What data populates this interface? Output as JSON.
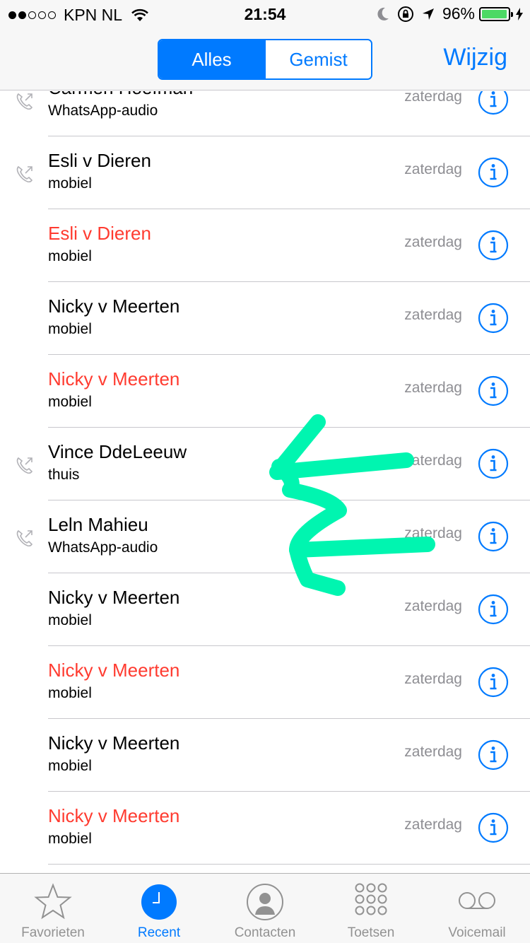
{
  "status_bar": {
    "carrier": "KPN NL",
    "time": "21:54",
    "battery_percent": "96%",
    "battery_level": 0.96,
    "signal_bars": 2,
    "signal_total": 5
  },
  "nav": {
    "segments": [
      "Alles",
      "Gemist"
    ],
    "active_segment": "Alles",
    "edit_label": "Wijzig"
  },
  "calls": [
    {
      "name": "Carmen Hoefman",
      "type": "WhatsApp-audio",
      "date": "zaterdag",
      "missed": false,
      "outgoing": true
    },
    {
      "name": "Esli v Dieren",
      "type": "mobiel",
      "date": "zaterdag",
      "missed": false,
      "outgoing": true
    },
    {
      "name": "Esli v Dieren",
      "type": "mobiel",
      "date": "zaterdag",
      "missed": true,
      "outgoing": false
    },
    {
      "name": "Nicky v Meerten",
      "type": "mobiel",
      "date": "zaterdag",
      "missed": false,
      "outgoing": false
    },
    {
      "name": "Nicky v Meerten",
      "type": "mobiel",
      "date": "zaterdag",
      "missed": true,
      "outgoing": false
    },
    {
      "name": "Vince DdeLeeuw",
      "type": "thuis",
      "date": "zaterdag",
      "missed": false,
      "outgoing": true
    },
    {
      "name": "Leln Mahieu",
      "type": "WhatsApp-audio",
      "date": "zaterdag",
      "missed": false,
      "outgoing": true
    },
    {
      "name": "Nicky v Meerten",
      "type": "mobiel",
      "date": "zaterdag",
      "missed": false,
      "outgoing": false
    },
    {
      "name": "Nicky v Meerten",
      "type": "mobiel",
      "date": "zaterdag",
      "missed": true,
      "outgoing": false
    },
    {
      "name": "Nicky v Meerten",
      "type": "mobiel",
      "date": "zaterdag",
      "missed": false,
      "outgoing": false
    },
    {
      "name": "Nicky v Meerten",
      "type": "mobiel",
      "date": "zaterdag",
      "missed": true,
      "outgoing": false
    }
  ],
  "tabs": [
    {
      "label": "Favorieten",
      "icon": "star-icon",
      "active": false
    },
    {
      "label": "Recent",
      "icon": "clock-icon",
      "active": true
    },
    {
      "label": "Contacten",
      "icon": "contact-icon",
      "active": false
    },
    {
      "label": "Toetsen",
      "icon": "keypad-icon",
      "active": false
    },
    {
      "label": "Voicemail",
      "icon": "voicemail-icon",
      "active": false
    }
  ],
  "colors": {
    "accent": "#007aff",
    "missed": "#ff3b30",
    "annotation": "#00f5b0",
    "battery": "#4cd964"
  }
}
